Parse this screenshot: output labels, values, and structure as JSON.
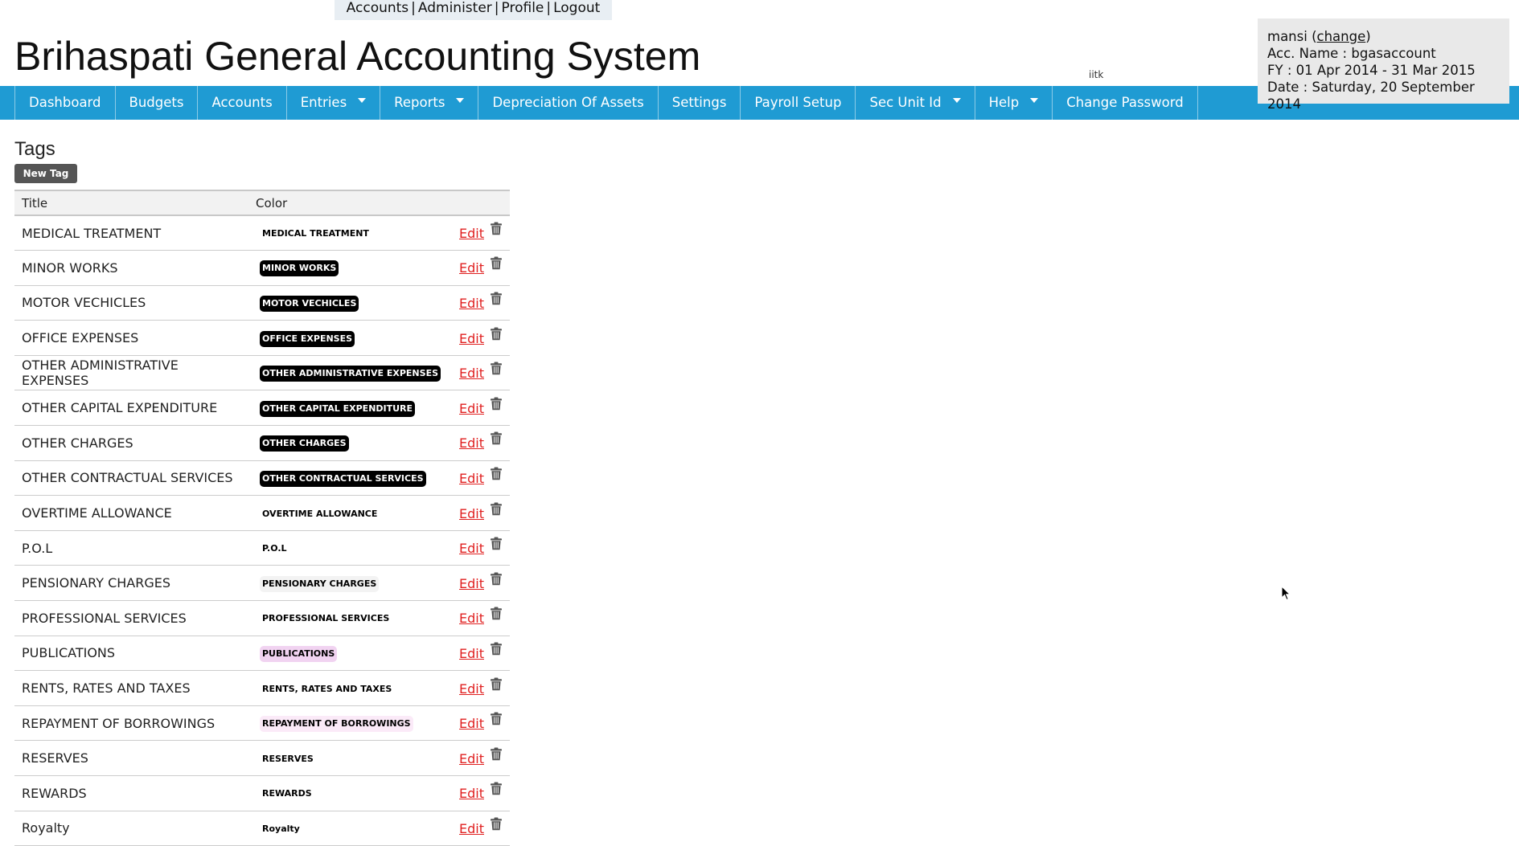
{
  "top_links": [
    "Accounts",
    "Administer",
    "Profile",
    "Logout"
  ],
  "app_title": "Brihaspati General Accounting System",
  "org_code": "iitk",
  "user": {
    "name": "mansi",
    "change_label": "change",
    "acc_name": "Acc. Name : bgasaccount",
    "fy": "FY : 01 Apr 2014 - 31 Mar 2015",
    "date": "Date : Saturday, 20 September 2014"
  },
  "nav": [
    {
      "label": "Dashboard",
      "dropdown": false
    },
    {
      "label": "Budgets",
      "dropdown": false
    },
    {
      "label": "Accounts",
      "dropdown": false
    },
    {
      "label": "Entries",
      "dropdown": true
    },
    {
      "label": "Reports",
      "dropdown": true
    },
    {
      "label": "Depreciation Of Assets",
      "dropdown": false
    },
    {
      "label": "Settings",
      "dropdown": false
    },
    {
      "label": "Payroll Setup",
      "dropdown": false
    },
    {
      "label": "Sec Unit Id",
      "dropdown": true
    },
    {
      "label": "Help",
      "dropdown": true
    },
    {
      "label": "Change Password",
      "dropdown": false
    }
  ],
  "page": {
    "title": "Tags",
    "new_tag_label": "New Tag",
    "columns": [
      "Title",
      "Color"
    ],
    "edit_label": "Edit"
  },
  "tags": [
    {
      "title": "MEDICAL TREATMENT",
      "label": "MEDICAL TREATMENT",
      "bg": "#ffffff",
      "fg": "#000000"
    },
    {
      "title": "MINOR WORKS",
      "label": "MINOR WORKS",
      "bg": "#000000",
      "fg": "#ffffff"
    },
    {
      "title": "MOTOR VECHICLES",
      "label": "MOTOR VECHICLES",
      "bg": "#000000",
      "fg": "#ffffff"
    },
    {
      "title": "OFFICE EXPENSES",
      "label": "OFFICE EXPENSES",
      "bg": "#000000",
      "fg": "#ffffff"
    },
    {
      "title": "OTHER ADMINISTRATIVE EXPENSES",
      "label": "OTHER ADMINISTRATIVE EXPENSES",
      "bg": "#000000",
      "fg": "#ffffff"
    },
    {
      "title": "OTHER CAPITAL EXPENDITURE",
      "label": "OTHER CAPITAL EXPENDITURE",
      "bg": "#000000",
      "fg": "#ffffff"
    },
    {
      "title": "OTHER CHARGES",
      "label": "OTHER CHARGES",
      "bg": "#000000",
      "fg": "#ffffff"
    },
    {
      "title": "OTHER CONTRACTUAL SERVICES",
      "label": "OTHER CONTRACTUAL SERVICES",
      "bg": "#000000",
      "fg": "#ffffff"
    },
    {
      "title": "OVERTIME ALLOWANCE",
      "label": "OVERTIME ALLOWANCE",
      "bg": "#ffffff",
      "fg": "#000000"
    },
    {
      "title": "P.O.L",
      "label": "P.O.L",
      "bg": "#ffffff",
      "fg": "#000000"
    },
    {
      "title": "PENSIONARY CHARGES",
      "label": "PENSIONARY CHARGES",
      "bg": "#f3f3f3",
      "fg": "#000000"
    },
    {
      "title": "PROFESSIONAL SERVICES",
      "label": "PROFESSIONAL SERVICES",
      "bg": "#ffffff",
      "fg": "#000000"
    },
    {
      "title": "PUBLICATIONS",
      "label": "PUBLICATIONS",
      "bg": "#f1d3f1",
      "fg": "#000000"
    },
    {
      "title": "RENTS, RATES AND TAXES",
      "label": "RENTS, RATES AND TAXES",
      "bg": "#ffffff",
      "fg": "#000000"
    },
    {
      "title": "REPAYMENT OF BORROWINGS",
      "label": "REPAYMENT OF BORROWINGS",
      "bg": "#fbeaf8",
      "fg": "#000000"
    },
    {
      "title": "RESERVES",
      "label": "RESERVES",
      "bg": "#ffffff",
      "fg": "#000000"
    },
    {
      "title": "REWARDS",
      "label": "REWARDS",
      "bg": "#ffffff",
      "fg": "#000000"
    },
    {
      "title": "Royalty",
      "label": "Royalty",
      "bg": "#ffffff",
      "fg": "#000000"
    }
  ],
  "colors": {
    "navbar": "#1f9bd3",
    "edit_link": "#e02020"
  }
}
